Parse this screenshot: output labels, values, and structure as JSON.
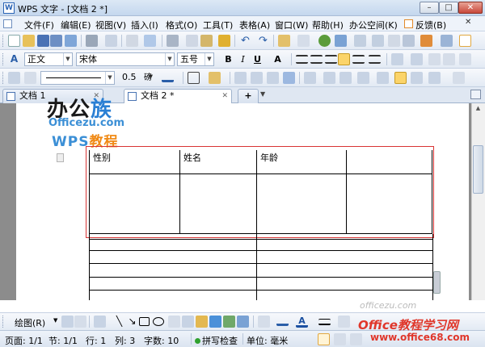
{
  "window": {
    "title": "WPS 文字 - [文档 2 *]",
    "app_icon": "W",
    "minimize_icon": "minimize-icon",
    "maximize_icon": "maximize-icon",
    "close_icon": "close-icon",
    "controls": {
      "min": "–",
      "max": "□",
      "close": "✕"
    }
  },
  "menu": {
    "items": [
      "文件(F)",
      "编辑(E)",
      "视图(V)",
      "插入(I)",
      "格式(O)",
      "工具(T)",
      "表格(A)",
      "窗口(W)",
      "帮助(H)",
      "办公空间(K)",
      "反馈(B)"
    ]
  },
  "format_toolbar": {
    "style": "正文",
    "font": "宋体",
    "size": "五号",
    "bold": "B",
    "italic": "I",
    "underline": "U",
    "font_color_letter": "A"
  },
  "table_toolbar": {
    "line_width": "0.5",
    "line_unit": "磅"
  },
  "tabs": [
    {
      "label": "文档 1"
    },
    {
      "label": "文档 2 *"
    }
  ],
  "new_tab_label": "+",
  "logo": {
    "line1_black": "办公",
    "line1_blue": "族",
    "url": "Officezu.com",
    "wps": "WPS",
    "wps_suffix": "教程"
  },
  "document_table": {
    "headers": [
      "性别",
      "姓名",
      "年龄",
      ""
    ]
  },
  "drawing_toolbar": {
    "draw_label": "绘图(R)"
  },
  "status": {
    "page": "页面: 1/1",
    "section": "节: 1/1",
    "row": "行: 1",
    "column": "列: 3",
    "word_count": "字数: 10",
    "spell_check": "拼写检查",
    "unit": "单位: 毫米"
  },
  "watermark": {
    "faint": "officezu.com",
    "site": "Office教程学习网",
    "url": "www.office68.com"
  }
}
